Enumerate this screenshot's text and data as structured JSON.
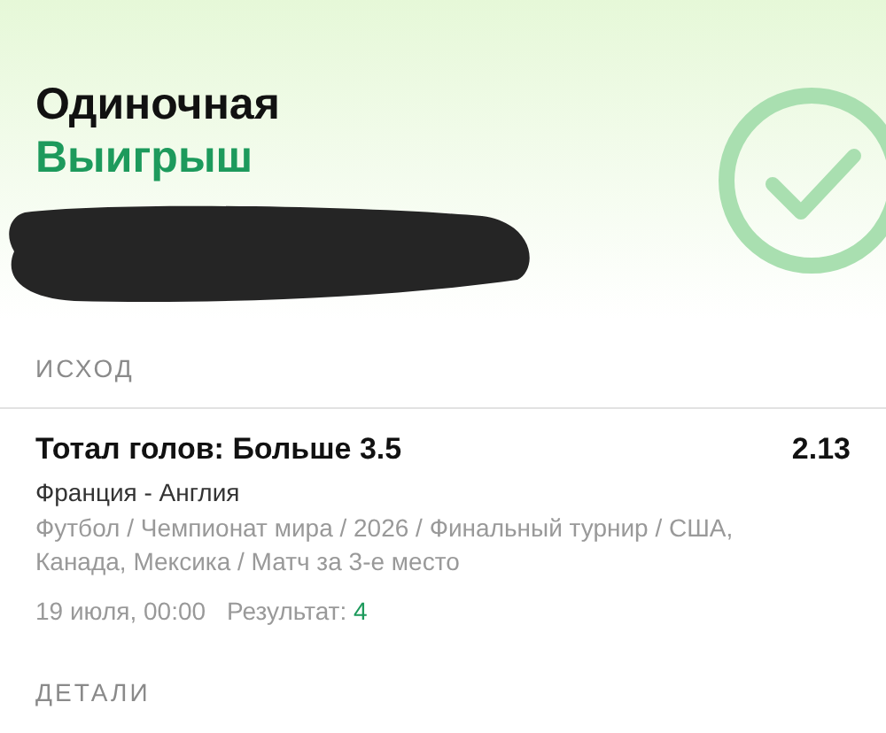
{
  "header": {
    "title": "Одиночная",
    "status": {
      "text": "Выигрыш",
      "kind": "won"
    }
  },
  "sections": [
    {
      "title": "ИСХОД"
    },
    {
      "title": "ДЕТАЛИ"
    }
  ],
  "outcome": {
    "selection": "Тотал голов: Больше 3.5",
    "odds": "2.13",
    "match": "Франция - Англия",
    "path": "Футбол / Чемпионат мира / 2026 / Финальный турнир / США, Канада, Мексика / Матч за 3-е место",
    "date": "19 июля, 00:00",
    "result_label": "Результат:",
    "result_value": "4"
  }
}
